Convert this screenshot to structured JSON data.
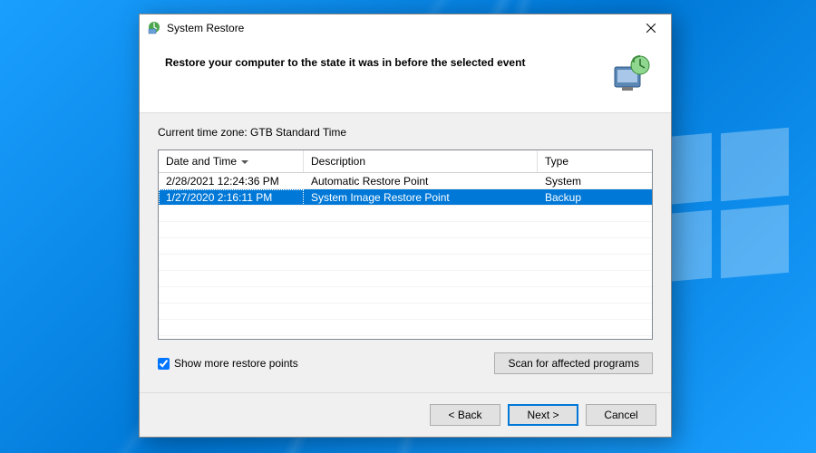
{
  "window": {
    "title": "System Restore"
  },
  "header": {
    "heading": "Restore your computer to the state it was in before the selected event"
  },
  "timezone_label": "Current time zone: GTB Standard Time",
  "grid": {
    "columns": {
      "date_time": "Date and Time",
      "description": "Description",
      "type": "Type"
    },
    "rows": [
      {
        "date_time": "2/28/2021 12:24:36 PM",
        "description": "Automatic Restore Point",
        "type": "System",
        "selected": false
      },
      {
        "date_time": "1/27/2020 2:16:11 PM",
        "description": "System Image Restore Point",
        "type": "Backup",
        "selected": true
      }
    ]
  },
  "checkbox": {
    "label": "Show more restore points",
    "checked": true
  },
  "buttons": {
    "scan": "Scan for affected programs",
    "back": "< Back",
    "next": "Next >",
    "cancel": "Cancel"
  }
}
